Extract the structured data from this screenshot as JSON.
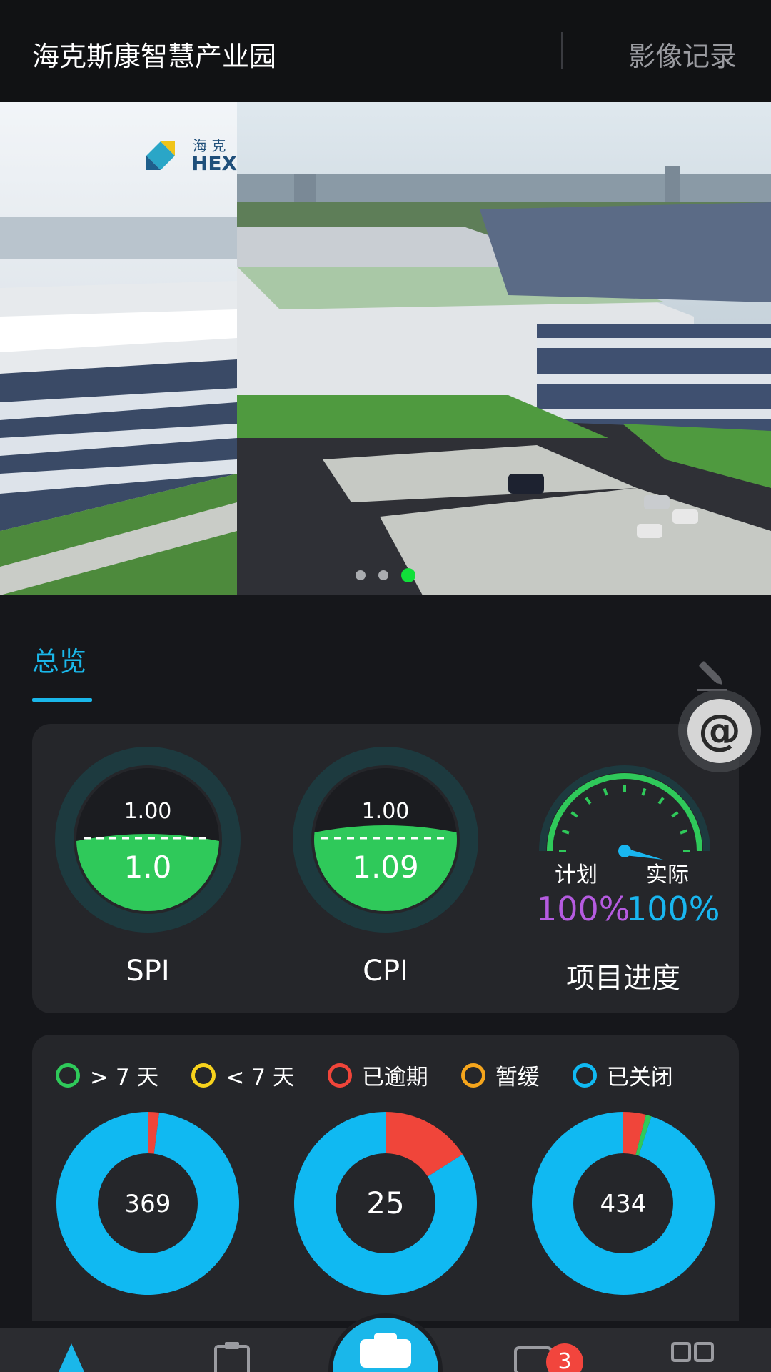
{
  "header": {
    "title": "海克斯康智慧产业园",
    "record_label": "影像记录"
  },
  "banner": {
    "slide_count": 3,
    "active_index": 2,
    "logo_text": "海 克",
    "logo_sub": "HEXA"
  },
  "tabs": [
    {
      "label": "总览",
      "active": true
    }
  ],
  "overview": {
    "spi": {
      "label": "SPI",
      "target": "1.00",
      "value": "1.0",
      "fill": 0.52
    },
    "cpi": {
      "label": "CPI",
      "target": "1.00",
      "value": "1.09",
      "fill": 0.58
    },
    "progress": {
      "title": "项目进度",
      "plan_label": "计划",
      "actual_label": "实际",
      "plan_value": "100%",
      "actual_value": "100%",
      "ratio": 1.0
    }
  },
  "status": {
    "legend": [
      {
        "label": "> 7 天",
        "color": "#2fc95a"
      },
      {
        "label": "< 7 天",
        "color": "#f7d21c"
      },
      {
        "label": "已逾期",
        "color": "#f0453a"
      },
      {
        "label": "暂缓",
        "color": "#f5a51c"
      },
      {
        "label": "已关闭",
        "color": "#10b9f2"
      }
    ],
    "donuts": [
      {
        "total": "369",
        "segments": {
          "overdue": 0.02,
          "gt7": 0.0,
          "closed": 0.98
        }
      },
      {
        "total": "25",
        "segments": {
          "overdue": 0.16,
          "gt7": 0.0,
          "closed": 0.84
        }
      },
      {
        "total": "434",
        "segments": {
          "overdue": 0.04,
          "gt7": 0.01,
          "closed": 0.95
        }
      }
    ]
  },
  "nav": {
    "badge_count": "3"
  },
  "colors": {
    "accent": "#1ab7ea",
    "gauge_green": "#2fc95a",
    "gauge_ring": "#1d3a3f",
    "closed": "#10b9f2",
    "overdue": "#f0453a",
    "gt7": "#2fc95a"
  }
}
